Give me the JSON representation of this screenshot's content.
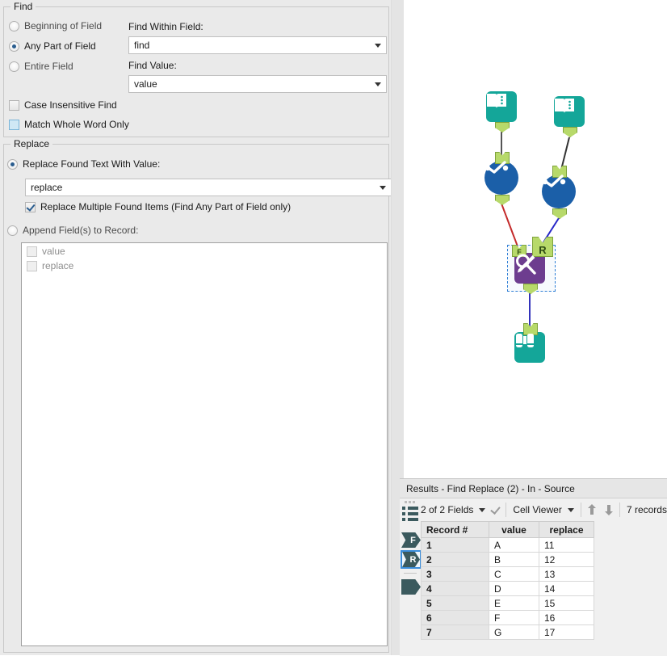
{
  "config": {
    "find_group": {
      "title": "Find",
      "match_mode_options": [
        {
          "label": "Beginning of Field",
          "selected": false
        },
        {
          "label": "Any Part of Field",
          "selected": true
        },
        {
          "label": "Entire Field",
          "selected": false
        }
      ],
      "case_insensitive": {
        "label": "Case Insensitive Find",
        "checked": false
      },
      "whole_word": {
        "label": "Match Whole Word Only",
        "checked": false
      },
      "find_within_field": {
        "label": "Find Within Field:",
        "value": "find"
      },
      "find_value": {
        "label": "Find Value:",
        "value": "value"
      }
    },
    "replace_group": {
      "title": "Replace",
      "replace_found_text": {
        "label": "Replace Found Text With Value:",
        "selected": true
      },
      "replace_value": "replace",
      "replace_multiple": {
        "label": "Replace Multiple Found Items (Find Any Part of Field only)",
        "checked": true
      },
      "append_fields": {
        "label": "Append Field(s) to Record:",
        "selected": false
      },
      "append_field_items": [
        {
          "label": "value",
          "checked": false
        },
        {
          "label": "replace",
          "checked": false
        }
      ]
    }
  },
  "canvas": {
    "tools": [
      {
        "name": "input-data-tool-1",
        "icon": "book-icon"
      },
      {
        "name": "input-data-tool-2",
        "icon": "book-icon"
      },
      {
        "name": "select-tool-1",
        "icon": "select-checkmark-icon"
      },
      {
        "name": "select-tool-2",
        "icon": "select-checkmark-icon"
      },
      {
        "name": "find-replace-tool",
        "icon": "find-replace-icon",
        "selected": true
      },
      {
        "name": "browse-tool",
        "icon": "binoculars-icon"
      }
    ],
    "anchors": {
      "find": "F",
      "replace": "R"
    },
    "connection_colors": {
      "source": "#c42b2b",
      "replace": "#2626c8",
      "plain": "#555555",
      "output": "#3333bb"
    }
  },
  "results": {
    "title": "Results - Find Replace (2) - In - Source",
    "toolbar": {
      "fields_selector": "2 of 2 Fields",
      "view_mode": "Cell Viewer",
      "record_count": "7 records"
    },
    "sidebar": {
      "list_icon": "list-icon",
      "anchor_f": "F",
      "anchor_r": "R",
      "anchor_out": ""
    },
    "table": {
      "columns": [
        "Record #",
        "value",
        "replace"
      ],
      "rows": [
        [
          "1",
          "A",
          "11"
        ],
        [
          "2",
          "B",
          "12"
        ],
        [
          "3",
          "C",
          "13"
        ],
        [
          "4",
          "D",
          "14"
        ],
        [
          "5",
          "E",
          "15"
        ],
        [
          "6",
          "F",
          "16"
        ],
        [
          "7",
          "G",
          "17"
        ]
      ]
    }
  },
  "colors": {
    "panel_bg": "#eaeaea",
    "teal": "#14a699",
    "purple": "#6d3d8f",
    "blue": "#1b5fa8",
    "anchor_green": "#b7d96a",
    "selection_blue": "#2f7fd6"
  }
}
